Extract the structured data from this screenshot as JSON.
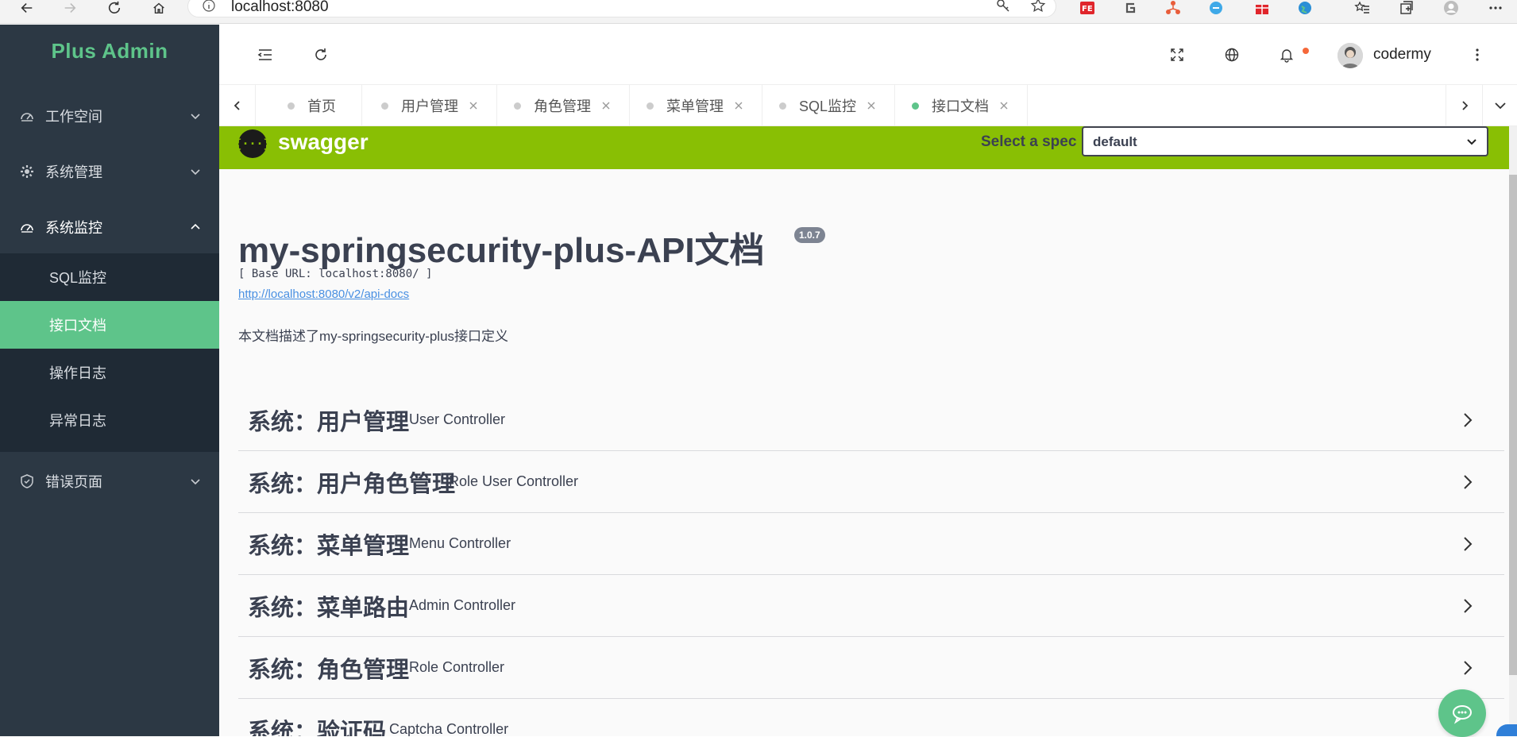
{
  "browser": {
    "url": "localhost:8080"
  },
  "sidebar": {
    "logo": "Plus Admin",
    "groups": [
      {
        "label": "工作空间",
        "icon": "dashboard-icon",
        "expanded": false
      },
      {
        "label": "系统管理",
        "icon": "gear-icon",
        "expanded": false
      },
      {
        "label": "系统监控",
        "icon": "dashboard-icon",
        "expanded": true
      },
      {
        "label": "错误页面",
        "icon": "shield-icon",
        "expanded": false
      }
    ],
    "submenu": [
      {
        "label": "SQL监控",
        "active": false
      },
      {
        "label": "接口文档",
        "active": true
      },
      {
        "label": "操作日志",
        "active": false
      },
      {
        "label": "异常日志",
        "active": false
      }
    ]
  },
  "header": {
    "username": "codermy"
  },
  "tabs": [
    {
      "label": "首页",
      "closable": false,
      "active": false
    },
    {
      "label": "用户管理",
      "closable": true,
      "active": false
    },
    {
      "label": "角色管理",
      "closable": true,
      "active": false
    },
    {
      "label": "菜单管理",
      "closable": true,
      "active": false
    },
    {
      "label": "SQL监控",
      "closable": true,
      "active": false
    },
    {
      "label": "接口文档",
      "closable": true,
      "active": true
    }
  ],
  "swagger": {
    "brand": "swagger",
    "logo_glyph": "{···}",
    "spec_label": "Select a spec",
    "spec_value": "default",
    "title": "my-springsecurity-plus-API文档",
    "version": "1.0.7",
    "base_url": "[ Base URL: localhost:8080/ ]",
    "docs_link": "http://localhost:8080/v2/api-docs",
    "description": "本文档描述了my-springsecurity-plus接口定义",
    "sections": [
      {
        "title": "系统：用户管理",
        "subtitle": "User Controller"
      },
      {
        "title": "系统：用户角色管理",
        "subtitle": "Role User Controller"
      },
      {
        "title": "系统：菜单管理",
        "subtitle": "Menu Controller"
      },
      {
        "title": "系统：菜单路由",
        "subtitle": "Admin Controller"
      },
      {
        "title": "系统：角色管理",
        "subtitle": "Role Controller"
      },
      {
        "title": "系统：验证码",
        "subtitle": "Captcha Controller"
      }
    ]
  },
  "colors": {
    "sidebar_bg": "#2c3844",
    "accent_green": "#5ec48a",
    "swagger_green": "#89bf04"
  }
}
